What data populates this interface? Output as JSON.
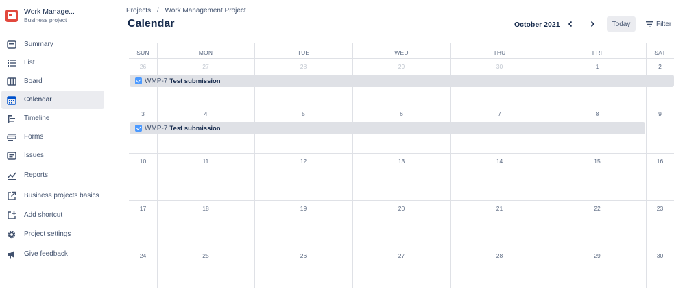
{
  "project": {
    "name": "Work Manage...",
    "type": "Business project",
    "icon": "project-avatar-icon",
    "color": "#e2483d"
  },
  "sidebar": {
    "items": [
      {
        "label": "Summary",
        "icon": "summary-icon"
      },
      {
        "label": "List",
        "icon": "list-icon"
      },
      {
        "label": "Board",
        "icon": "board-icon"
      },
      {
        "label": "Calendar",
        "icon": "calendar-icon",
        "active": true
      },
      {
        "label": "Timeline",
        "icon": "timeline-icon"
      },
      {
        "label": "Forms",
        "icon": "forms-icon"
      },
      {
        "label": "Issues",
        "icon": "issues-icon"
      },
      {
        "label": "Reports",
        "icon": "reports-icon"
      },
      {
        "label": "Business projects basics",
        "icon": "external-link-icon"
      },
      {
        "label": "Add shortcut",
        "icon": "add-shortcut-icon"
      },
      {
        "label": "Project settings",
        "icon": "gear-icon"
      },
      {
        "label": "Give feedback",
        "icon": "megaphone-icon"
      }
    ]
  },
  "breadcrumb": {
    "root": "Projects",
    "separator": "/",
    "current": "Work Management Project"
  },
  "page_title": "Calendar",
  "toolbar": {
    "month": "October 2021",
    "prev_icon": "chevron-left-icon",
    "next_icon": "chevron-right-icon",
    "today_label": "Today",
    "filter_label": "Filter",
    "filter_icon": "filter-icon"
  },
  "calendar": {
    "weekdays": [
      "SUN",
      "MON",
      "TUE",
      "WED",
      "THU",
      "FRI",
      "SAT"
    ],
    "weeks": [
      [
        "26",
        "27",
        "28",
        "29",
        "30",
        "1",
        "2"
      ],
      [
        "3",
        "4",
        "5",
        "6",
        "7",
        "8",
        "9"
      ],
      [
        "10",
        "11",
        "12",
        "13",
        "14",
        "15",
        "16"
      ],
      [
        "17",
        "18",
        "19",
        "20",
        "21",
        "22",
        "23"
      ],
      [
        "24",
        "25",
        "26",
        "27",
        "28",
        "29",
        "30"
      ]
    ],
    "faded_in_first_week": 5,
    "events": [
      {
        "key": "WMP-7",
        "summary": "Test submission"
      },
      {
        "key": "WMP-7",
        "summary": "Test submission"
      }
    ]
  },
  "colors": {
    "accent": "#4c9aff",
    "event_bg": "#dfe1e6",
    "active_nav": "#ebecf0"
  }
}
